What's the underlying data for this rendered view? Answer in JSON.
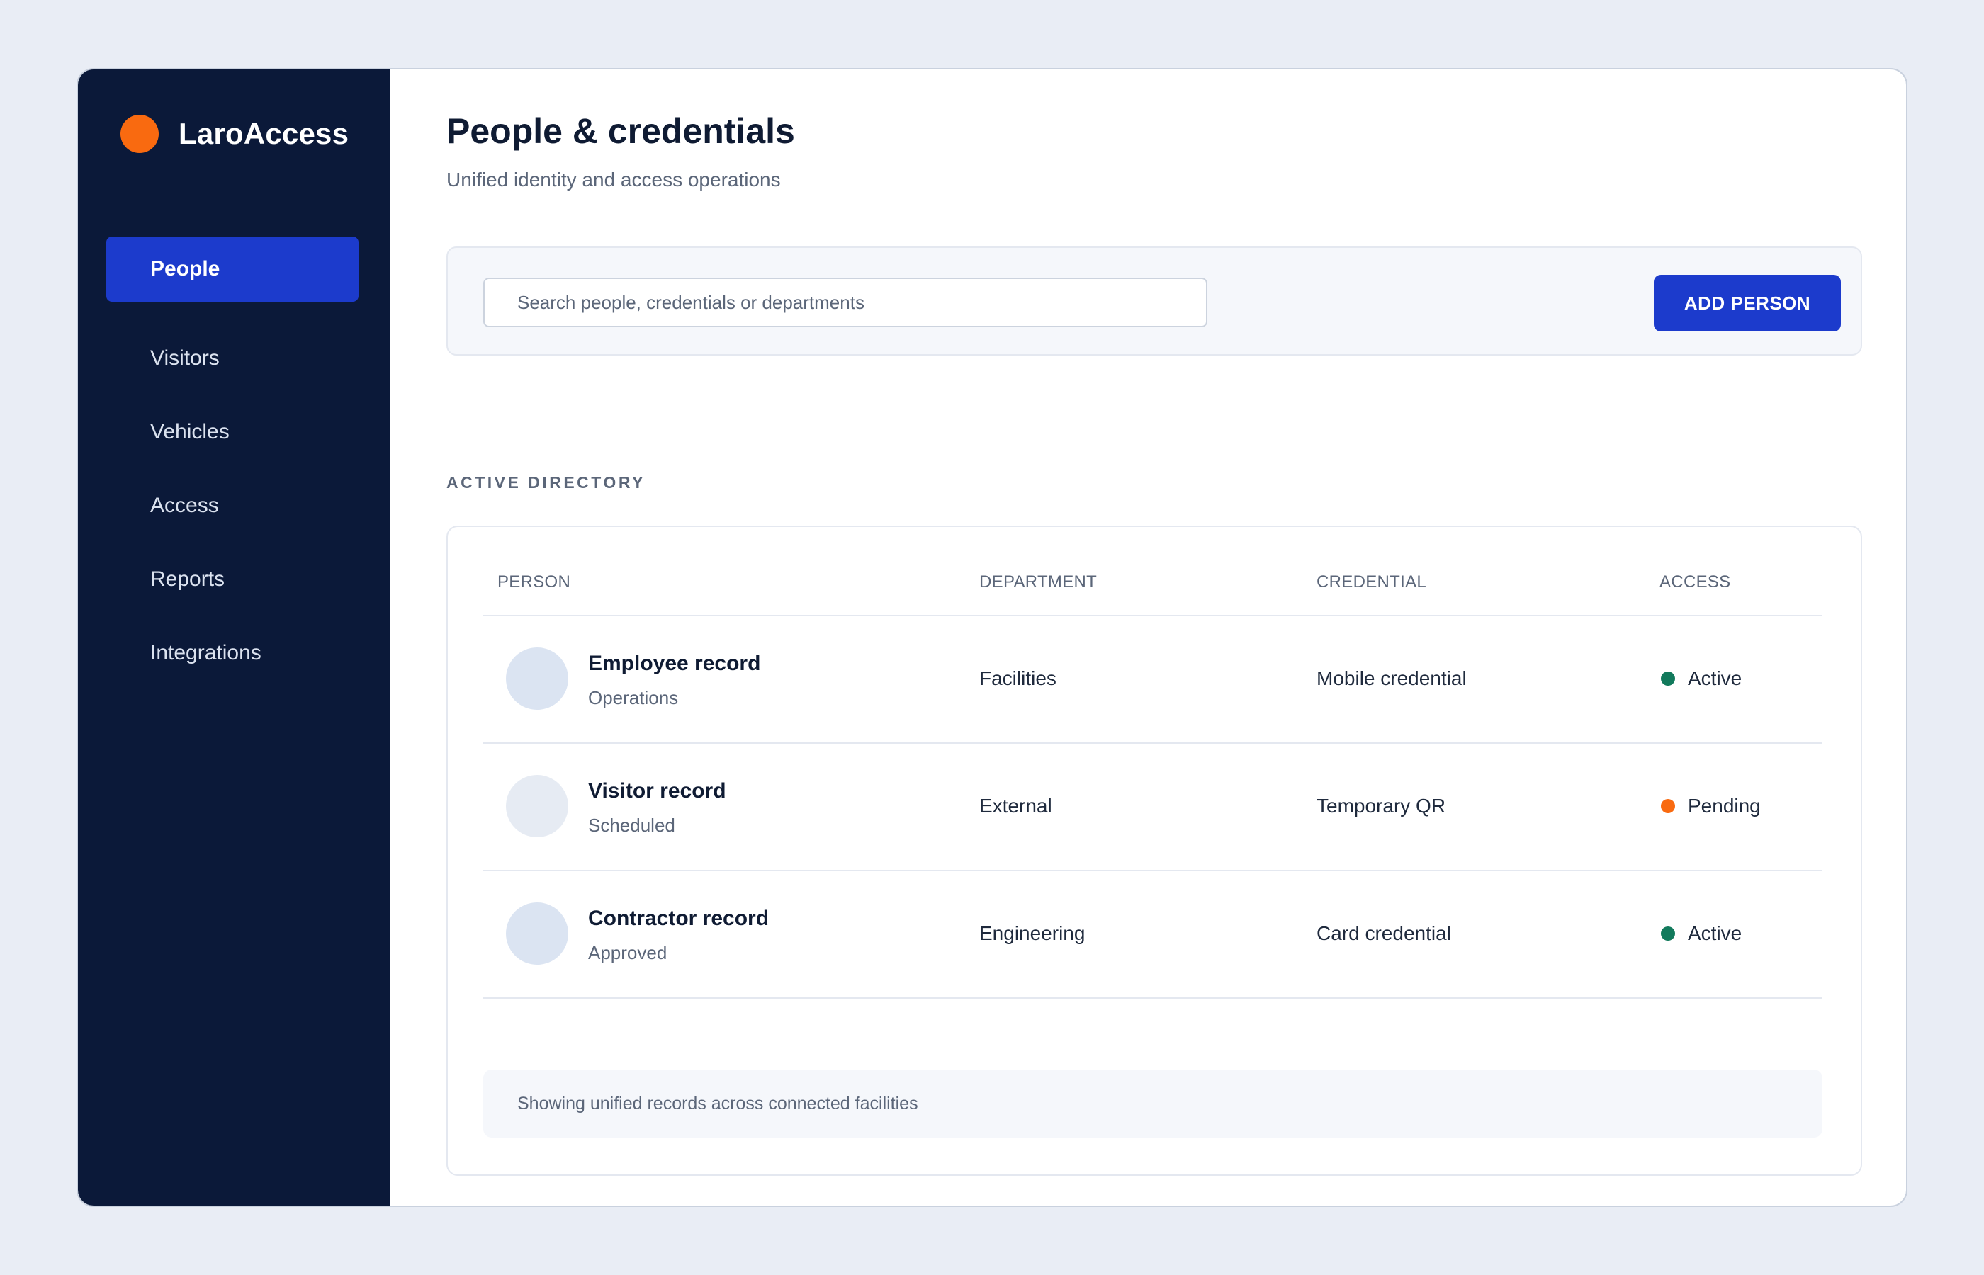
{
  "app": {
    "brand_name": "LaroAccess",
    "brand_color": "#f96a10"
  },
  "sidebar": {
    "items": [
      {
        "label": "People",
        "active": true
      },
      {
        "label": "Visitors",
        "active": false
      },
      {
        "label": "Vehicles",
        "active": false
      },
      {
        "label": "Access",
        "active": false
      },
      {
        "label": "Reports",
        "active": false
      },
      {
        "label": "Integrations",
        "active": false
      }
    ]
  },
  "header": {
    "title": "People & credentials",
    "subtitle": "Unified identity and access operations"
  },
  "toolbar": {
    "search_placeholder": "Search people, credentials or departments",
    "add_label": "ADD PERSON"
  },
  "directory": {
    "section_label": "ACTIVE DIRECTORY",
    "columns": [
      "PERSON",
      "DEPARTMENT",
      "CREDENTIAL",
      "ACCESS"
    ],
    "rows": [
      {
        "name": "Employee record",
        "sub": "Operations",
        "department": "Facilities",
        "credential": "Mobile credential",
        "access": "Active",
        "status_color": "#127a5c"
      },
      {
        "name": "Visitor record",
        "sub": "Scheduled",
        "department": "External",
        "credential": "Temporary QR",
        "access": "Pending",
        "status_color": "#f96a10"
      },
      {
        "name": "Contractor record",
        "sub": "Approved",
        "department": "Engineering",
        "credential": "Card credential",
        "access": "Active",
        "status_color": "#127a5c"
      }
    ],
    "footer_note": "Showing unified records across connected facilities"
  },
  "colors": {
    "accent": "#1c3bcc",
    "sidebar_bg": "#0b1939",
    "status_active": "#127a5c",
    "status_pending": "#f96a10"
  }
}
